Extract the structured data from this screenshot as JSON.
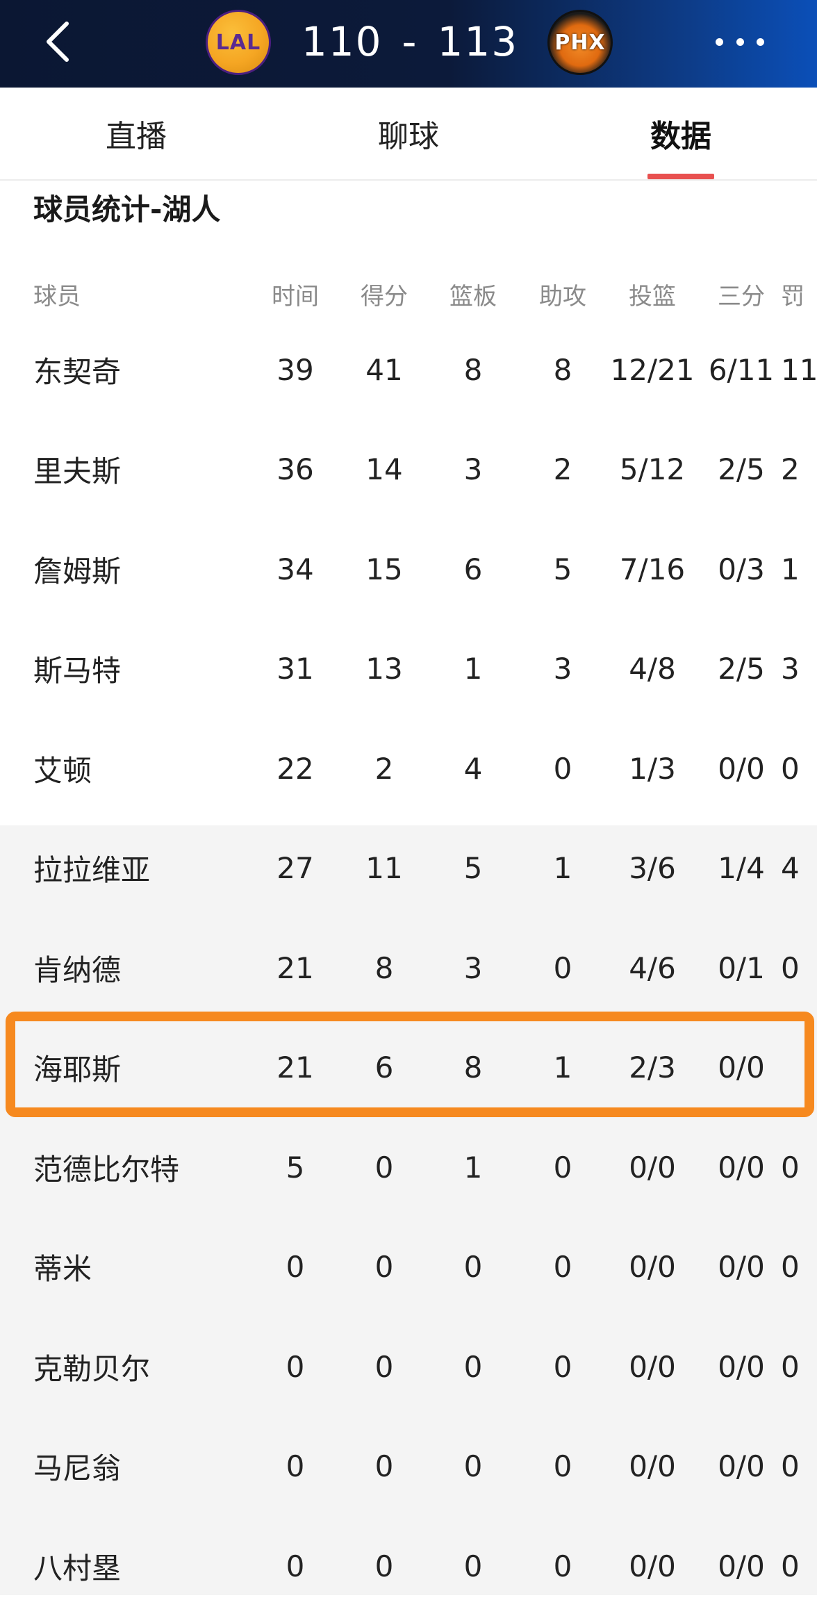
{
  "topbar": {
    "home_team": "LAL",
    "away_team": "PHX",
    "home_score": "110",
    "separator": "-",
    "away_score": "113"
  },
  "tabs": [
    {
      "label": "直播",
      "active": false
    },
    {
      "label": "聊球",
      "active": false
    },
    {
      "label": "数据",
      "active": true
    }
  ],
  "section_title": "球员统计-湖人",
  "table": {
    "headers": [
      "球员",
      "时间",
      "得分",
      "篮板",
      "助攻",
      "投篮",
      "三分",
      "罚"
    ],
    "rows": [
      {
        "name": "东契奇",
        "min": "39",
        "pts": "41",
        "reb": "8",
        "ast": "8",
        "fg": "12/21",
        "tp": "6/11",
        "ft": "11"
      },
      {
        "name": "里夫斯",
        "min": "36",
        "pts": "14",
        "reb": "3",
        "ast": "2",
        "fg": "5/12",
        "tp": "2/5",
        "ft": "2"
      },
      {
        "name": "詹姆斯",
        "min": "34",
        "pts": "15",
        "reb": "6",
        "ast": "5",
        "fg": "7/16",
        "tp": "0/3",
        "ft": "1"
      },
      {
        "name": "斯马特",
        "min": "31",
        "pts": "13",
        "reb": "1",
        "ast": "3",
        "fg": "4/8",
        "tp": "2/5",
        "ft": "3"
      },
      {
        "name": "艾顿",
        "min": "22",
        "pts": "2",
        "reb": "4",
        "ast": "0",
        "fg": "1/3",
        "tp": "0/0",
        "ft": "0"
      },
      {
        "name": "拉拉维亚",
        "min": "27",
        "pts": "11",
        "reb": "5",
        "ast": "1",
        "fg": "3/6",
        "tp": "1/4",
        "ft": "4"
      },
      {
        "name": "肯纳德",
        "min": "21",
        "pts": "8",
        "reb": "3",
        "ast": "0",
        "fg": "4/6",
        "tp": "0/1",
        "ft": "0"
      },
      {
        "name": "海耶斯",
        "min": "21",
        "pts": "6",
        "reb": "8",
        "ast": "1",
        "fg": "2/3",
        "tp": "0/0",
        "ft": "",
        "highlighted": true
      },
      {
        "name": "范德比尔特",
        "min": "5",
        "pts": "0",
        "reb": "1",
        "ast": "0",
        "fg": "0/0",
        "tp": "0/0",
        "ft": "0"
      },
      {
        "name": "蒂米",
        "min": "0",
        "pts": "0",
        "reb": "0",
        "ast": "0",
        "fg": "0/0",
        "tp": "0/0",
        "ft": "0"
      },
      {
        "name": "克勒贝尔",
        "min": "0",
        "pts": "0",
        "reb": "0",
        "ast": "0",
        "fg": "0/0",
        "tp": "0/0",
        "ft": "0"
      },
      {
        "name": "马尼翁",
        "min": "0",
        "pts": "0",
        "reb": "0",
        "ast": "0",
        "fg": "0/0",
        "tp": "0/0",
        "ft": "0"
      },
      {
        "name": "八村塁",
        "min": "0",
        "pts": "0",
        "reb": "0",
        "ast": "0",
        "fg": "0/0",
        "tp": "0/0",
        "ft": "0"
      }
    ]
  },
  "colors": {
    "topbar_dark": "#0b1733",
    "topbar_blue": "#0b4fb8",
    "active_tab_underline": "#e8504f",
    "highlight_border": "#f6891f",
    "bench_background": "#f4f4f4"
  }
}
